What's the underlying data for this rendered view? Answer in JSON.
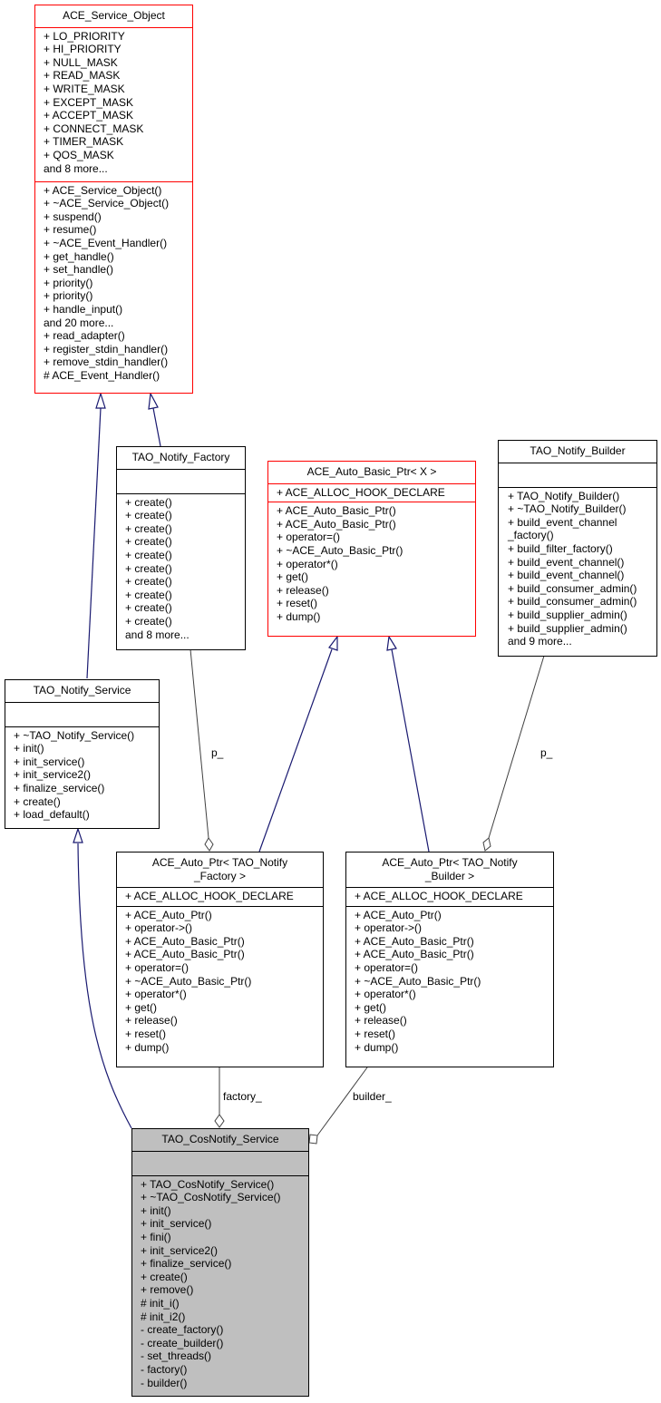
{
  "colors": {
    "inheritance_edge": "#191970",
    "association_edge": "#404040",
    "highlight_fill": "#bfbfbf",
    "external_border": "#ff0000"
  },
  "classes": {
    "ace_service_object": {
      "title": "ACE_Service_Object",
      "attributes": [
        "+ LO_PRIORITY",
        "+ HI_PRIORITY",
        "+ NULL_MASK",
        "+ READ_MASK",
        "+ WRITE_MASK",
        "+ EXCEPT_MASK",
        "+ ACCEPT_MASK",
        "+ CONNECT_MASK",
        "+ TIMER_MASK",
        "+ QOS_MASK",
        "and 8 more..."
      ],
      "methods": [
        "+ ACE_Service_Object()",
        "+ ~ACE_Service_Object()",
        "+ suspend()",
        "+ resume()",
        "+ ~ACE_Event_Handler()",
        "+ get_handle()",
        "+ set_handle()",
        "+ priority()",
        "+ priority()",
        "+ handle_input()",
        "and 20 more...",
        "+ read_adapter()",
        "+ register_stdin_handler()",
        "+ remove_stdin_handler()",
        "# ACE_Event_Handler()"
      ]
    },
    "tao_notify_factory": {
      "title": "TAO_Notify_Factory",
      "attributes": [],
      "methods": [
        "+ create()",
        "+ create()",
        "+ create()",
        "+ create()",
        "+ create()",
        "+ create()",
        "+ create()",
        "+ create()",
        "+ create()",
        "+ create()",
        "and 8 more..."
      ]
    },
    "ace_auto_basic_ptr": {
      "title": "ACE_Auto_Basic_Ptr< X >",
      "attributes": [
        "+ ACE_ALLOC_HOOK_DECLARE"
      ],
      "methods": [
        "+ ACE_Auto_Basic_Ptr()",
        "+ ACE_Auto_Basic_Ptr()",
        "+ operator=()",
        "+ ~ACE_Auto_Basic_Ptr()",
        "+ operator*()",
        "+ get()",
        "+ release()",
        "+ reset()",
        "+ dump()"
      ]
    },
    "tao_notify_builder": {
      "title": "TAO_Notify_Builder",
      "attributes": [],
      "methods": [
        "+ TAO_Notify_Builder()",
        "+ ~TAO_Notify_Builder()",
        "+ build_event_channel",
        "_factory()",
        "+ build_filter_factory()",
        "+ build_event_channel()",
        "+ build_event_channel()",
        "+ build_consumer_admin()",
        "+ build_consumer_admin()",
        "+ build_supplier_admin()",
        "+ build_supplier_admin()",
        "and 9 more..."
      ]
    },
    "tao_notify_service": {
      "title": "TAO_Notify_Service",
      "attributes": [],
      "methods": [
        "+ ~TAO_Notify_Service()",
        "+ init()",
        "+ init_service()",
        "+ init_service2()",
        "+ finalize_service()",
        "+ create()",
        "+ load_default()"
      ]
    },
    "ace_auto_ptr_factory": {
      "title_lines": [
        "ACE_Auto_Ptr< TAO_Notify",
        "_Factory >"
      ],
      "attributes": [
        "+ ACE_ALLOC_HOOK_DECLARE"
      ],
      "methods": [
        "+ ACE_Auto_Ptr()",
        "+ operator->()",
        "+ ACE_Auto_Basic_Ptr()",
        "+ ACE_Auto_Basic_Ptr()",
        "+ operator=()",
        "+ ~ACE_Auto_Basic_Ptr()",
        "+ operator*()",
        "+ get()",
        "+ release()",
        "+ reset()",
        "+ dump()"
      ]
    },
    "ace_auto_ptr_builder": {
      "title_lines": [
        "ACE_Auto_Ptr< TAO_Notify",
        "_Builder >"
      ],
      "attributes": [
        "+ ACE_ALLOC_HOOK_DECLARE"
      ],
      "methods": [
        "+ ACE_Auto_Ptr()",
        "+ operator->()",
        "+ ACE_Auto_Basic_Ptr()",
        "+ ACE_Auto_Basic_Ptr()",
        "+ operator=()",
        "+ ~ACE_Auto_Basic_Ptr()",
        "+ operator*()",
        "+ get()",
        "+ release()",
        "+ reset()",
        "+ dump()"
      ]
    },
    "tao_cosnotify_service": {
      "title": "TAO_CosNotify_Service",
      "attributes": [],
      "methods": [
        "+ TAO_CosNotify_Service()",
        "+ ~TAO_CosNotify_Service()",
        "+ init()",
        "+ init_service()",
        "+ fini()",
        "+ init_service2()",
        "+ finalize_service()",
        "+ create()",
        "+ remove()",
        "# init_i()",
        "# init_i2()",
        "- create_factory()",
        "- create_builder()",
        "- set_threads()",
        "- factory()",
        "- builder()"
      ]
    }
  },
  "edge_labels": {
    "factory_p": "p_",
    "builder_p": "p_",
    "factory_member": "factory_",
    "builder_member": "builder_"
  }
}
